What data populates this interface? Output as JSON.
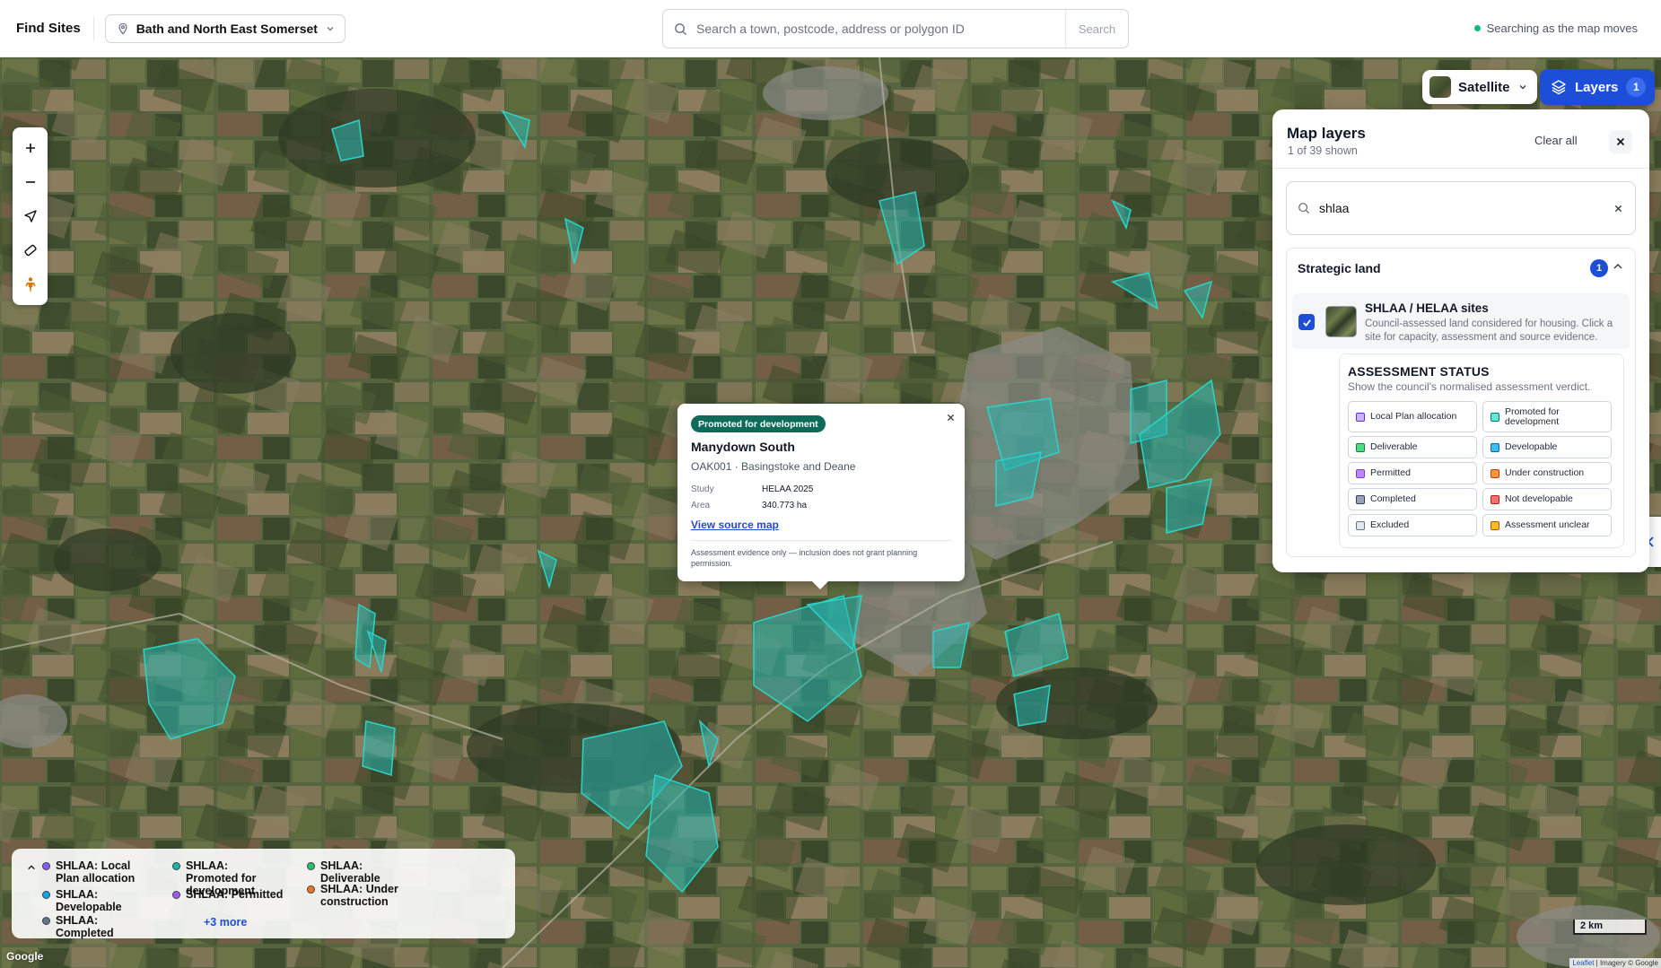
{
  "app": {
    "title": "Find Sites"
  },
  "region": {
    "label": "Bath and North East Somerset"
  },
  "search": {
    "placeholder": "Search a town, postcode, address or polygon ID",
    "value": "",
    "button": "Search"
  },
  "status_text": "Searching as the map moves",
  "basemap": {
    "label": "Satellite"
  },
  "layers_button": {
    "label": "Layers",
    "count": "1"
  },
  "panel": {
    "title": "Map layers",
    "subtitle": "1 of 39 shown",
    "clear_all": "Clear all",
    "search_value": "shlaa",
    "group": {
      "title": "Strategic land",
      "count": "1",
      "layer": {
        "name": "SHLAA / HELAA sites",
        "description": "Council-assessed land considered for housing. Click a site for capacity, assessment and source evidence.",
        "checked": true
      },
      "status": {
        "title": "ASSESSMENT STATUS",
        "subtitle": "Show the council's normalised assessment verdict.",
        "chips": [
          {
            "label": "Local Plan allocation",
            "color": "#6d28d9",
            "fill": "#c4b5fd"
          },
          {
            "label": "Promoted for development",
            "color": "#0f766e",
            "fill": "#5eead4"
          },
          {
            "label": "Deliverable",
            "color": "#15803d",
            "fill": "#4ade80"
          },
          {
            "label": "Developable",
            "color": "#0369a1",
            "fill": "#38bdf8"
          },
          {
            "label": "Permitted",
            "color": "#7c3aed",
            "fill": "#c084fc"
          },
          {
            "label": "Under construction",
            "color": "#c2410c",
            "fill": "#fb923c"
          },
          {
            "label": "Completed",
            "color": "#334155",
            "fill": "#94a3b8"
          },
          {
            "label": "Not developable",
            "color": "#b91c1c",
            "fill": "#f87171"
          },
          {
            "label": "Excluded",
            "color": "#64748b",
            "fill": "#e2e8f0"
          },
          {
            "label": "Assessment unclear",
            "color": "#b45309",
            "fill": "#fbbf24"
          }
        ]
      }
    }
  },
  "popup": {
    "badge": "Promoted for development",
    "title": "Manydown South",
    "meta": "OAK001 · Basingstoke and Deane",
    "study_label": "Study",
    "study_value": "HELAA 2025",
    "area_label": "Area",
    "area_value": "340.773 ha",
    "link": "View source map",
    "note": "Assessment evidence only — inclusion does not grant planning permission."
  },
  "legend": {
    "items": [
      {
        "label": "SHLAA: Local Plan allocation",
        "color": "#8b5cf6"
      },
      {
        "label": "SHLAA: Promoted for development",
        "color": "#14b8a6"
      },
      {
        "label": "SHLAA: Deliverable",
        "color": "#22c55e"
      },
      {
        "label": "SHLAA: Developable",
        "color": "#0ea5e9"
      },
      {
        "label": "SHLAA: Permitted",
        "color": "#a855f7"
      },
      {
        "label": "SHLAA: Under construction",
        "color": "#f97316"
      },
      {
        "label": "SHLAA: Completed",
        "color": "#64748b"
      }
    ],
    "more": "+3 more"
  },
  "map_footer": {
    "provider": "Google",
    "scale": "2 km",
    "attribution_leaflet": "Leaflet",
    "attribution_imagery": "| Imagery © Google"
  },
  "colors": {
    "accent": "#1d4ed8",
    "site_fill": "#27b5b0",
    "site_stroke": "#2bd4c8"
  }
}
